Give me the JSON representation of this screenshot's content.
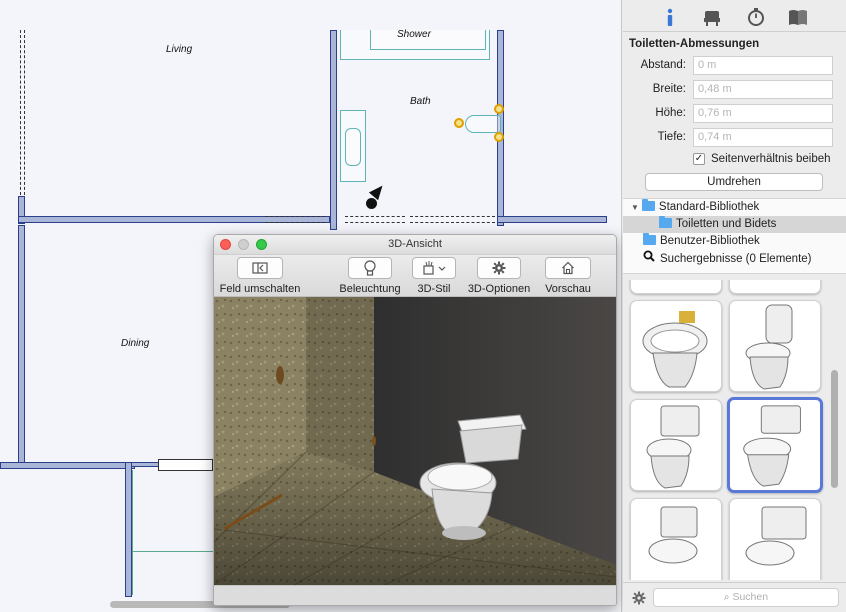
{
  "plan": {
    "rooms": {
      "living": "Living",
      "shower": "Shower",
      "bath": "Bath",
      "dining": "Dining"
    }
  },
  "window3d": {
    "title": "3D-Ansicht",
    "toolbar": {
      "toggle_field": "Feld umschalten",
      "lighting": "Beleuchtung",
      "style3d": "3D-Stil",
      "options3d": "3D-Optionen",
      "preview": "Vorschau"
    }
  },
  "sidebar": {
    "tabs": [
      "info-icon",
      "furniture-icon",
      "stopwatch-icon",
      "book-icon"
    ],
    "section_title": "Toiletten-Abmessungen",
    "fields": [
      {
        "label": "Abstand:",
        "value": "0 m"
      },
      {
        "label": "Breite:",
        "value": "0,48 m"
      },
      {
        "label": "Höhe:",
        "value": "0,76 m"
      },
      {
        "label": "Tiefe:",
        "value": "0,74 m"
      }
    ],
    "aspect_checkbox": {
      "label": "Seitenverhältnis beibeh",
      "checked": true
    },
    "flip_button": "Umdrehen",
    "tree": {
      "standard_library": "Standard-Bibliothek",
      "toilets_bidets": "Toiletten und Bidets",
      "user_library": "Benutzer-Bibliothek",
      "search_results": "Suchergebnisse (0 Elemente)"
    },
    "search_placeholder": "Suchen",
    "accent_color": "#5a78d8"
  }
}
